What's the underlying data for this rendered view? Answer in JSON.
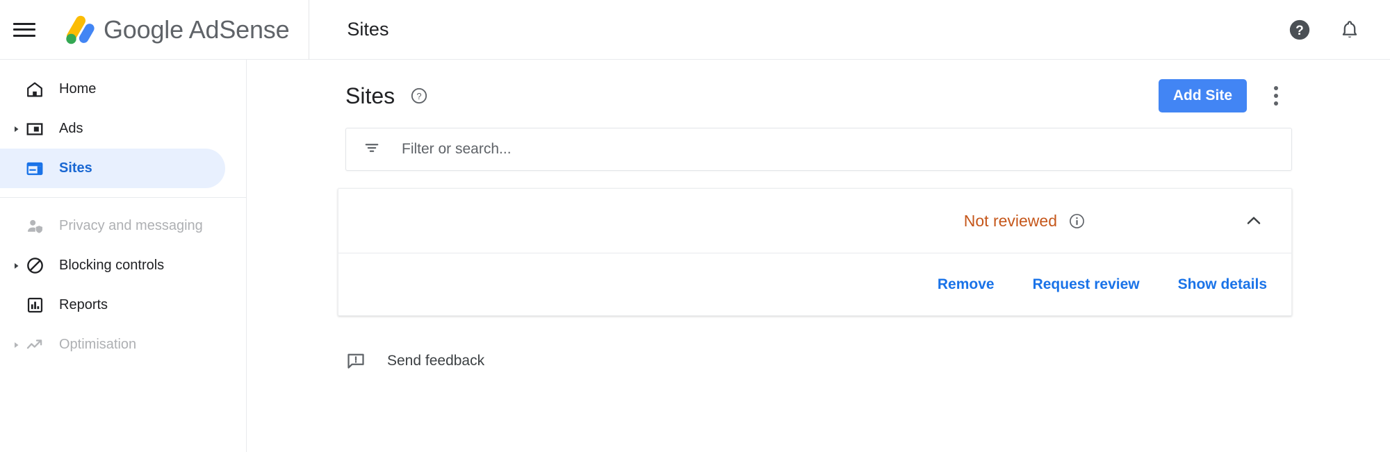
{
  "brand": {
    "name": "Google AdSense",
    "logo_icon": "adsense-logo-icon",
    "menu_icon": "hamburger-menu-icon"
  },
  "topbar": {
    "title": "Sites",
    "help_icon": "help-circle-filled-icon",
    "notifications_icon": "bell-icon"
  },
  "sidebar": {
    "items": [
      {
        "label": "Home",
        "icon": "home-icon",
        "state": "default",
        "expandable": false
      },
      {
        "label": "Ads",
        "icon": "ads-icon",
        "state": "default",
        "expandable": true
      },
      {
        "label": "Sites",
        "icon": "sites-icon",
        "state": "active",
        "expandable": false
      },
      {
        "label": "Privacy and messaging",
        "icon": "person-shield-icon",
        "state": "disabled",
        "expandable": false
      },
      {
        "label": "Blocking controls",
        "icon": "block-icon",
        "state": "default",
        "expandable": true
      },
      {
        "label": "Reports",
        "icon": "bar-chart-icon",
        "state": "default",
        "expandable": false
      },
      {
        "label": "Optimisation",
        "icon": "trending-up-icon",
        "state": "disabled",
        "expandable": true
      }
    ]
  },
  "main": {
    "page_title": "Sites",
    "page_help_icon": "help-outline-icon",
    "add_site_label": "Add Site",
    "more_options_icon": "kebab-menu-icon",
    "search": {
      "placeholder": "Filter or search...",
      "value": "",
      "filter_icon": "filter-list-icon"
    },
    "site_card": {
      "status_label": "Not reviewed",
      "status_color": "#c5571b",
      "status_info_icon": "info-outline-icon",
      "collapse_icon": "chevron-up-icon",
      "actions": [
        {
          "label": "Remove"
        },
        {
          "label": "Request review"
        },
        {
          "label": "Show details"
        }
      ]
    },
    "feedback": {
      "label": "Send feedback",
      "icon": "feedback-icon"
    }
  },
  "colors": {
    "accent_blue": "#1a73e8",
    "button_blue": "#4285f4",
    "active_bg": "#e8f0fe",
    "warning_orange": "#c5571b"
  }
}
